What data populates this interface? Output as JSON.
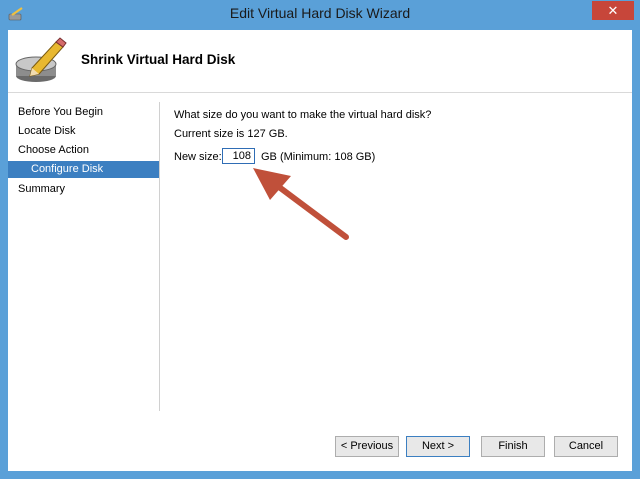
{
  "window": {
    "title": "Edit Virtual Hard Disk Wizard",
    "close_glyph": "✕"
  },
  "header": {
    "title": "Shrink Virtual Hard Disk"
  },
  "nav": {
    "items": [
      {
        "label": "Before You Begin"
      },
      {
        "label": "Locate Disk"
      },
      {
        "label": "Choose Action"
      },
      {
        "label": "Configure Disk"
      },
      {
        "label": "Summary"
      }
    ]
  },
  "main": {
    "question": "What size do you want to make the virtual hard disk?",
    "current_size": "Current size is 127 GB.",
    "new_size_label": "New size:",
    "new_size_value": "108",
    "new_size_unit": "GB (Minimum: 108 GB)"
  },
  "buttons": {
    "previous": "< Previous",
    "next": "Next >",
    "finish": "Finish",
    "cancel": "Cancel"
  },
  "colors": {
    "title_bar": "#5aa0d8",
    "selected_nav": "#3c7fc1",
    "annotation_arrow": "#c0503a"
  }
}
